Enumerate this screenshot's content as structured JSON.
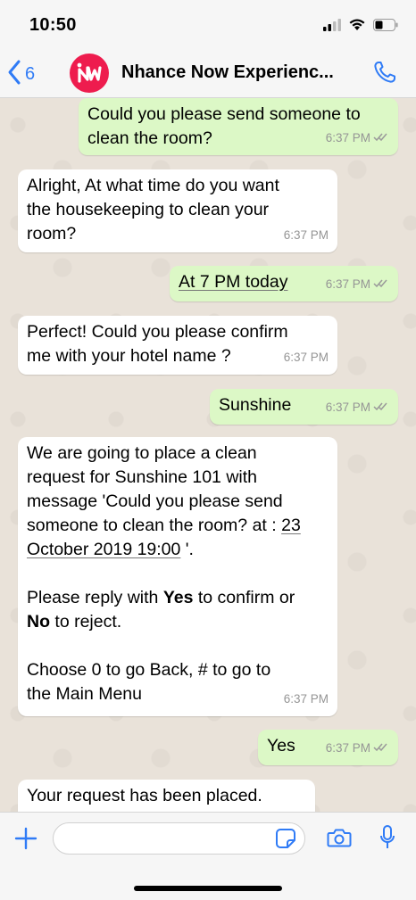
{
  "status_bar": {
    "time": "10:50"
  },
  "header": {
    "back_count": "6",
    "title": "Nhance Now Experienc..."
  },
  "messages": [
    {
      "direction": "out",
      "text": "Could you please send someone to\nclean the room?",
      "time": "6:37 PM",
      "status": "read"
    },
    {
      "direction": "in",
      "text": "Alright,  At what time do you want\nthe housekeeping to clean your\nroom?",
      "time": "6:37 PM"
    },
    {
      "direction": "out",
      "text": "At 7 PM today",
      "time": "6:37 PM",
      "status": "read"
    },
    {
      "direction": "in",
      "text": "Perfect! Could you please confirm\nme with your hotel name ?",
      "time": "6:37 PM"
    },
    {
      "direction": "out",
      "text": "Sunshine",
      "time": "6:37 PM",
      "status": "read"
    },
    {
      "direction": "in",
      "line1": "We are going to place a clean",
      "line2": "request for Sunshine 101 with",
      "line3": "message 'Could you please send",
      "line4_prefix": "someone to clean the room? at : ",
      "line4_date": "23",
      "line5_date": "October 2019 19:00",
      "line5_suffix": " '.",
      "confirm_prefix": "Please reply with ",
      "confirm_yes": "Yes",
      "confirm_mid": " to confirm or",
      "confirm_no": "No",
      "confirm_suffix": " to reject.",
      "choose_text": "Choose  0 to go Back, # to go to\nthe Main Menu",
      "time": "6:37 PM"
    },
    {
      "direction": "out",
      "text": "Yes",
      "time": "6:37 PM",
      "status": "read"
    },
    {
      "direction": "in",
      "text": "Your request has been placed.",
      "time": ""
    }
  ],
  "input": {
    "placeholder": "",
    "value": ""
  },
  "icons": {
    "back": "chevron-left-icon",
    "call": "phone-icon",
    "plus": "plus-icon",
    "sticker": "sticker-icon",
    "camera": "camera-icon",
    "mic": "microphone-icon",
    "read": "double-check-icon"
  },
  "colors": {
    "outgoing_bubble": "#dcf8c6",
    "incoming_bubble": "#ffffff",
    "accent": "#2f7bf6",
    "brand": "#ee1c4e",
    "read_ticks": "#34b7f1"
  }
}
